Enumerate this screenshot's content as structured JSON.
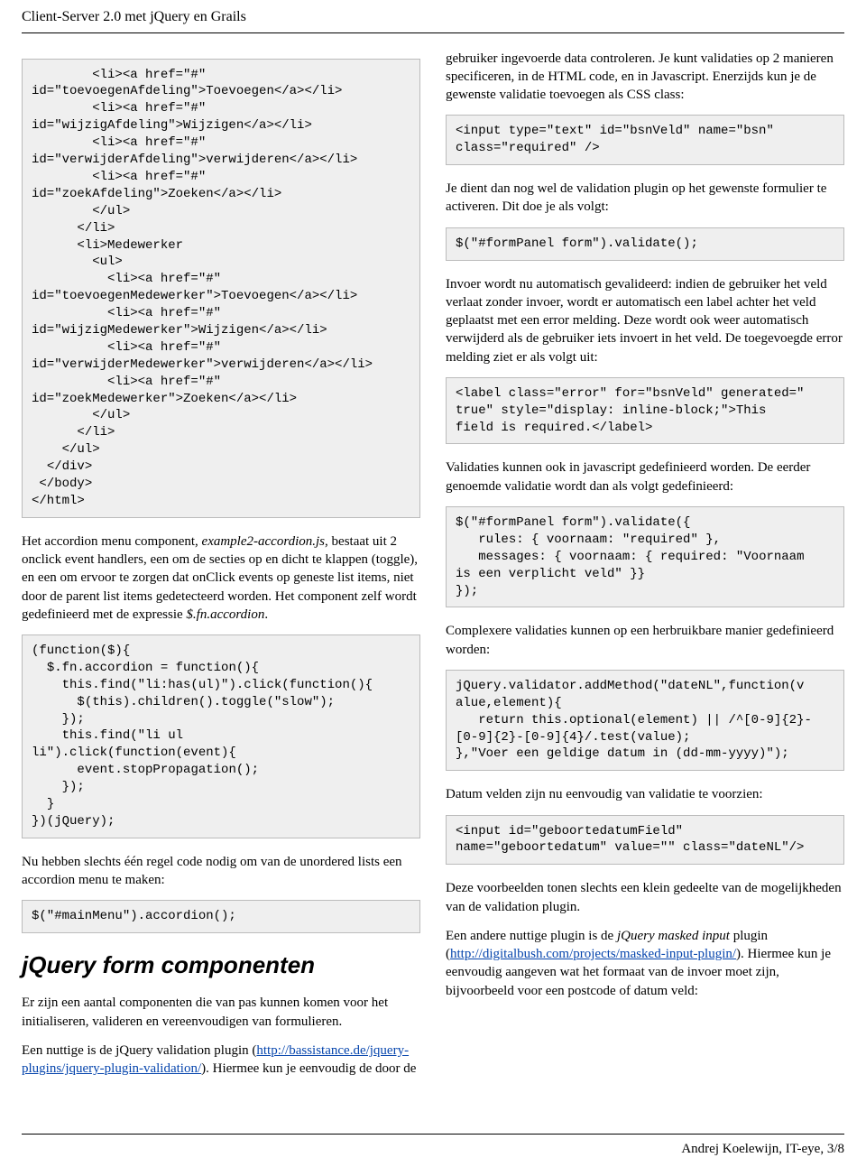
{
  "header": {
    "title": "Client-Server 2.0 met jQuery en Grails"
  },
  "left": {
    "code1": "        <li><a href=\"#\"\nid=\"toevoegenAfdeling\">Toevoegen</a></li>\n        <li><a href=\"#\"\nid=\"wijzigAfdeling\">Wijzigen</a></li>\n        <li><a href=\"#\"\nid=\"verwijderAfdeling\">verwijderen</a></li>\n        <li><a href=\"#\"\nid=\"zoekAfdeling\">Zoeken</a></li>\n        </ul>\n      </li>\n      <li>Medewerker\n        <ul>\n          <li><a href=\"#\"\nid=\"toevoegenMedewerker\">Toevoegen</a></li>\n          <li><a href=\"#\"\nid=\"wijzigMedewerker\">Wijzigen</a></li>\n          <li><a href=\"#\"\nid=\"verwijderMedewerker\">verwijderen</a></li>\n          <li><a href=\"#\"\nid=\"zoekMedewerker\">Zoeken</a></li>\n        </ul>\n      </li>\n    </ul>\n  </div>\n </body>\n</html>",
    "para1_a": "Het accordion menu component, ",
    "para1_em": "example2-accordion.js",
    "para1_b": ", bestaat uit 2 onclick event handlers, een om de secties op en dicht te klappen (toggle), en een om ervoor te zorgen dat onClick events op geneste list items, niet door de parent list items gedetecteerd worden. Het component zelf wordt gedefinieerd met de expressie ",
    "para1_em2": "$.fn.accordion",
    "para1_c": ".",
    "code2": "(function($){\n  $.fn.accordion = function(){\n    this.find(\"li:has(ul)\").click(function(){\n      $(this).children().toggle(\"slow\");\n    });\n    this.find(\"li ul\nli\").click(function(event){\n      event.stopPropagation();\n    });\n  }\n})(jQuery);",
    "para2": "Nu hebben slechts één regel code nodig om van de unordered lists een accordion menu te maken:",
    "code3": "$(\"#mainMenu\").accordion();",
    "h2": "jQuery form componenten",
    "para3": "Er zijn een aantal componenten die van pas kunnen komen voor het initialiseren, valideren en vereenvoudigen van formulieren.",
    "para4_a": "Een nuttige is de jQuery validation plugin (",
    "para4_link": "http://bassistance.de/jquery-plugins/jquery-plugin-validation/",
    "para4_b": "). Hiermee kun je eenvoudig de door de"
  },
  "right": {
    "para1": "gebruiker ingevoerde data controleren. Je kunt validaties op 2 manieren specificeren, in de HTML code, en in Javascript. Enerzijds kun je de gewenste validatie toevoegen als CSS class:",
    "code1": "<input type=\"text\" id=\"bsnVeld\" name=\"bsn\"\nclass=\"required\" />",
    "para2": "Je dient dan nog wel de validation plugin op het gewenste formulier te activeren. Dit doe je als volgt:",
    "code2": "$(\"#formPanel form\").validate();",
    "para3": "Invoer wordt nu automatisch gevalideerd: indien de gebruiker het veld verlaat zonder invoer, wordt er automatisch een label achter het veld geplaatst met een error melding. Deze wordt ook weer automatisch verwijderd als de gebruiker iets invoert in het veld. De toegevoegde error melding ziet er als volgt uit:",
    "code3": "<label class=\"error\" for=\"bsnVeld\" generated=\"\ntrue\" style=\"display: inline-block;\">This\nfield is required.</label>",
    "para4": "Validaties kunnen ook in javascript gedefinieerd worden. De eerder genoemde validatie wordt dan als volgt gedefinieerd:",
    "code4": "$(\"#formPanel form\").validate({\n   rules: { voornaam: \"required\" },\n   messages: { voornaam: { required: \"Voornaam\nis een verplicht veld\" }}\n});",
    "para5": "Complexere validaties kunnen op een herbruikbare manier gedefinieerd worden:",
    "code5": "jQuery.validator.addMethod(\"dateNL\",function(v\nalue,element){\n   return this.optional(element) || /^[0-9]{2}-\n[0-9]{2}-[0-9]{4}/.test(value);\n},\"Voer een geldige datum in (dd-mm-yyyy)\");",
    "para6": "Datum velden zijn nu eenvoudig van validatie te voorzien:",
    "code6": "<input id=\"geboortedatumField\"\nname=\"geboortedatum\" value=\"\" class=\"dateNL\"/>",
    "para7": "Deze voorbeelden tonen slechts een klein gedeelte van de mogelijkheden van de validation plugin.",
    "para8_a": "Een andere nuttige plugin is de ",
    "para8_em": "jQuery masked input",
    "para8_b": " plugin (",
    "para8_link": "http://digitalbush.com/projects/masked-input-plugin/",
    "para8_c": "). Hiermee kun je eenvoudig aangeven wat het formaat van de invoer moet zijn, bijvoorbeeld voor een postcode of datum veld:"
  },
  "footer": {
    "text": "Andrej Koelewijn, IT-eye, 3/8"
  }
}
